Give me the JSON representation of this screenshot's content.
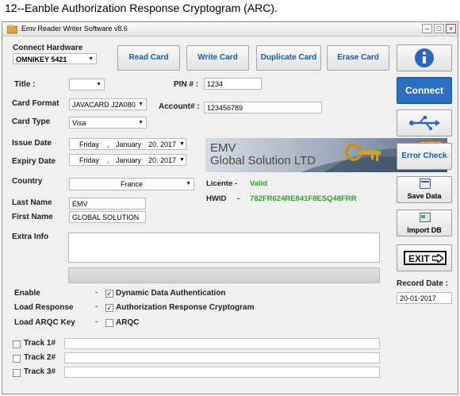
{
  "caption": "12--Eanble Authorization Response Cryptogram (ARC).",
  "window": {
    "title": "Emv Reader Writer Software v8.6",
    "controls": [
      "–",
      "□",
      "×"
    ]
  },
  "hardware": {
    "label": "Connect Hardware",
    "value": "OMNIKEY 5421"
  },
  "toolbar": {
    "read": "Read Card",
    "write": "Write Card",
    "duplicate": "Duplicate Card",
    "erase": "Erase Card"
  },
  "form": {
    "title_label": "Title :",
    "title_value": "",
    "pin_label": "PIN # :",
    "pin_value": "1234",
    "card_format_label": "Card Format",
    "card_format_value": "JAVACARD J2A080",
    "account_label": "Account# :",
    "account_value": "123456789",
    "card_type_label": "Card Type",
    "card_type_value": "Visa",
    "issue_date_label": "Issue Date",
    "issue_date": {
      "day": "Friday",
      "month": "January",
      "date": "20, 2017"
    },
    "expiry_date_label": "Expiry Date",
    "expiry_date": {
      "day": "Friday",
      "month": "January",
      "date": "20, 2017"
    },
    "country_label": "Country",
    "country_value": "France",
    "last_name_label": "Last Name",
    "last_name_value": "EMV",
    "first_name_label": "First Name",
    "first_name_value": "GLOBAL SOLUTION",
    "extra_info_label": "Extra Info",
    "extra_info_value": ""
  },
  "banner": {
    "line1": "EMV",
    "line2": "Global Solution LTD"
  },
  "license": {
    "label": "Licente -",
    "status": "Valid",
    "hwid_label": "HWID",
    "hwid_sep": "-",
    "hwid_value": "782FR624RE841F8ESQ48FRR"
  },
  "options": {
    "enable_label": "Enable",
    "enable_text": "Dynamic Data Authentication",
    "enable_checked": true,
    "load_response_label": "Load Response",
    "load_response_text": "Authorization Response Cryptogram",
    "load_response_checked": true,
    "load_arqc_label": "Load ARQC Key",
    "load_arqc_text": "ARQC",
    "load_arqc_checked": false,
    "dash": "-"
  },
  "tracks": [
    {
      "label": "Track 1#",
      "checked": false,
      "value": ""
    },
    {
      "label": "Track 2#",
      "checked": false,
      "value": ""
    },
    {
      "label": "Track 3#",
      "checked": false,
      "value": ""
    }
  ],
  "side": {
    "info_icon": "info-icon",
    "connect": "Connect",
    "usb_icon": "usb-icon",
    "error_check": "Error Check",
    "save_data": "Save Data",
    "import_db": "Import DB",
    "exit": "EXIT",
    "record_date_label": "Record Date :",
    "record_date_value": "20-01-2017"
  },
  "colors": {
    "accent_blue": "#1a5aa8",
    "connect_bg": "#2b6fc4",
    "valid_green": "#2aa52a"
  }
}
